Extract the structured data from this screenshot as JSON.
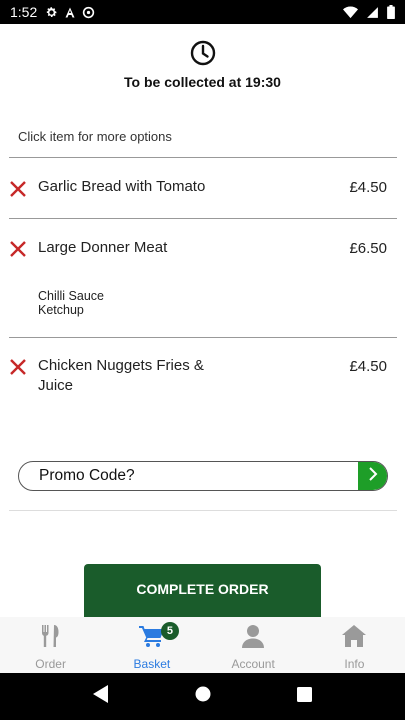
{
  "status_bar": {
    "time": "1:52",
    "icons": [
      "gear-icon",
      "a-icon",
      "at-icon",
      "wifi-icon",
      "signal-icon",
      "battery-icon"
    ]
  },
  "collection": {
    "icon": "clock-icon",
    "text": "To be collected at 19:30"
  },
  "hint": "Click item for more options",
  "items": [
    {
      "name": "Garlic Bread with Tomato",
      "price": "£4.50",
      "options": []
    },
    {
      "name": "Large Donner Meat",
      "price": "£6.50",
      "options": [
        "Chilli Sauce",
        "Ketchup"
      ]
    },
    {
      "name": "Chicken Nuggets Fries & Juice",
      "price": "£4.50",
      "options": []
    }
  ],
  "promo": {
    "label": "Promo Code?",
    "go_icon": "chevron-right-icon"
  },
  "complete_order_label": "COMPLETE ORDER",
  "tabs": [
    {
      "label": "Order",
      "icon": "fork-knife-icon",
      "active": false
    },
    {
      "label": "Basket",
      "icon": "cart-icon",
      "active": true,
      "badge": "5"
    },
    {
      "label": "Account",
      "icon": "user-icon",
      "active": false
    },
    {
      "label": "Info",
      "icon": "home-icon",
      "active": false
    }
  ],
  "colors": {
    "primary_green": "#1a5c2b",
    "promo_green": "#1e9e28",
    "active_tab": "#2b7be0",
    "remove_red": "#c62828"
  }
}
